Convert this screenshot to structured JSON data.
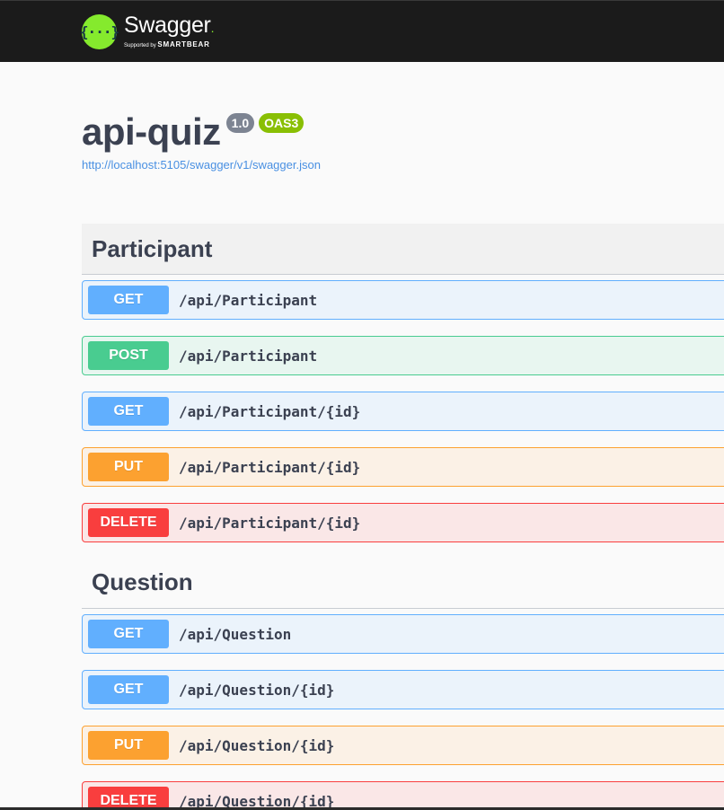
{
  "topbar": {
    "logo_glyph": "{···}",
    "logo_name": "Swagger",
    "logo_supported": "Supported by",
    "logo_brand": "SMARTBEAR"
  },
  "info": {
    "title": "api-quiz",
    "version": "1.0",
    "oas": "OAS3",
    "spec_url": "http://localhost:5105/swagger/v1/swagger.json"
  },
  "colors": {
    "get": "#61affe",
    "post": "#49cc90",
    "put": "#fca130",
    "delete": "#f93e3e",
    "accent": "#85ea2d"
  },
  "tags": [
    {
      "name": "Participant",
      "operations": [
        {
          "method": "GET",
          "path": "/api/Participant"
        },
        {
          "method": "POST",
          "path": "/api/Participant"
        },
        {
          "method": "GET",
          "path": "/api/Participant/{id}"
        },
        {
          "method": "PUT",
          "path": "/api/Participant/{id}"
        },
        {
          "method": "DELETE",
          "path": "/api/Participant/{id}"
        }
      ]
    },
    {
      "name": "Question",
      "operations": [
        {
          "method": "GET",
          "path": "/api/Question"
        },
        {
          "method": "GET",
          "path": "/api/Question/{id}"
        },
        {
          "method": "PUT",
          "path": "/api/Question/{id}"
        },
        {
          "method": "DELETE",
          "path": "/api/Question/{id}"
        }
      ]
    }
  ]
}
